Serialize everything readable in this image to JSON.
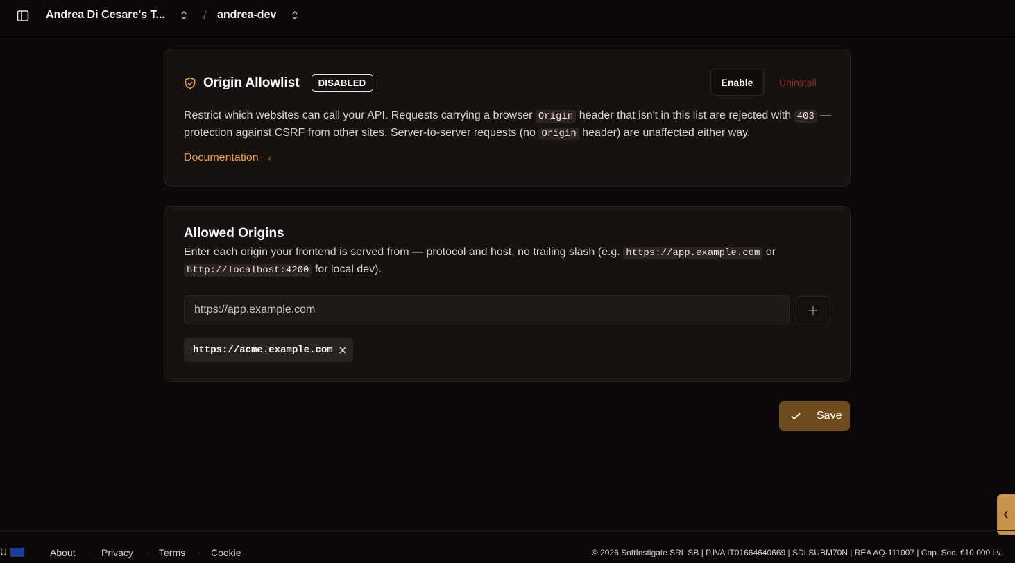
{
  "header": {
    "team_name": "Andrea Di Cesare's T...",
    "separator": "/",
    "project_name": "andrea-dev"
  },
  "origin_allowlist": {
    "title": "Origin Allowlist",
    "status_badge": "DISABLED",
    "enable_label": "Enable",
    "uninstall_label": "Uninstall",
    "desc_1": "Restrict which websites can call your API. Requests carrying a browser ",
    "code_origin": "Origin",
    "desc_2": " header that isn't in this list are rejected with ",
    "code_403": "403",
    "desc_3": " — protection against CSRF from other sites. Server-to-server requests (no ",
    "desc_4": " header) are unaffected either way.",
    "documentation_link": "Documentation →"
  },
  "allowed_origins": {
    "title": "Allowed Origins",
    "desc_1": "Enter each origin your frontend is served from — protocol and host, no trailing slash (e.g. ",
    "code_example_1": "https://app.example.com",
    "desc_2": " or ",
    "code_example_2": "http://localhost:4200",
    "desc_3": " for local dev).",
    "input_placeholder": "https://app.example.com",
    "origins": [
      "https://acme.example.com"
    ]
  },
  "save_label": "Save",
  "footer": {
    "region_label": "U",
    "links": [
      "About",
      "Privacy",
      "Terms",
      "Cookie"
    ],
    "separator": "·",
    "copyright": "© 2026 SoftInstigate SRL SB | P.IVA IT01664640669 | SDI SUBM70N | REA AQ-111007 | Cap. Soc. €10.000 i.v."
  },
  "colors": {
    "accent": "#e79c43",
    "danger": "#8a2f2a",
    "save_bg": "#6e4b1c"
  }
}
